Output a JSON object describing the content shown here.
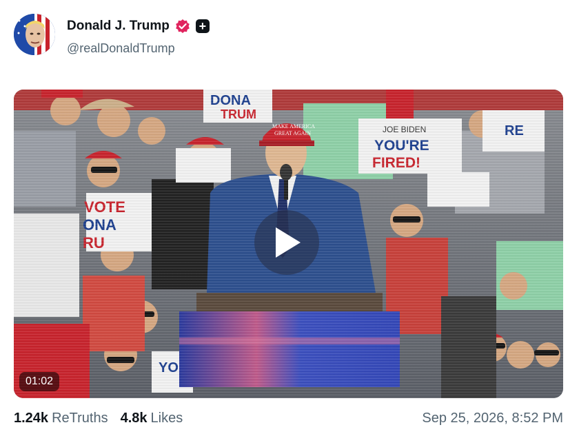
{
  "author": {
    "display_name": "Donald J. Trump",
    "handle": "@realDonaldTrump",
    "avatar_icon": "portrait-avatar",
    "verified_icon": "verified-badge-icon",
    "verified_color": "#e0245e",
    "extra_badge_icon": "plus-badge-icon"
  },
  "media": {
    "duration": "01:02",
    "play_icon": "play-icon",
    "signs": {
      "sign1": "DONA",
      "sign2": "TRUM",
      "sign3": "JOE BIDEN",
      "sign4": "YOU'RE",
      "sign5": "FIRED!",
      "sign6": "VOTE",
      "sign7": "ONA",
      "sign8": "RU",
      "sign9": "RE",
      "sign10": "YO",
      "hat_text1": "MAKE AMERICA",
      "hat_text2": "GREAT AGAIN"
    }
  },
  "stats": {
    "retruths_count": "1.24k",
    "retruths_label": "ReTruths",
    "likes_count": "4.8k",
    "likes_label": "Likes"
  },
  "timestamp": "Sep 25, 2026, 8:52 PM",
  "colors": {
    "text_primary": "#0f1419",
    "text_secondary": "#536471",
    "crowd_red": "#c8232c",
    "suit_blue": "#2d4f8e"
  }
}
